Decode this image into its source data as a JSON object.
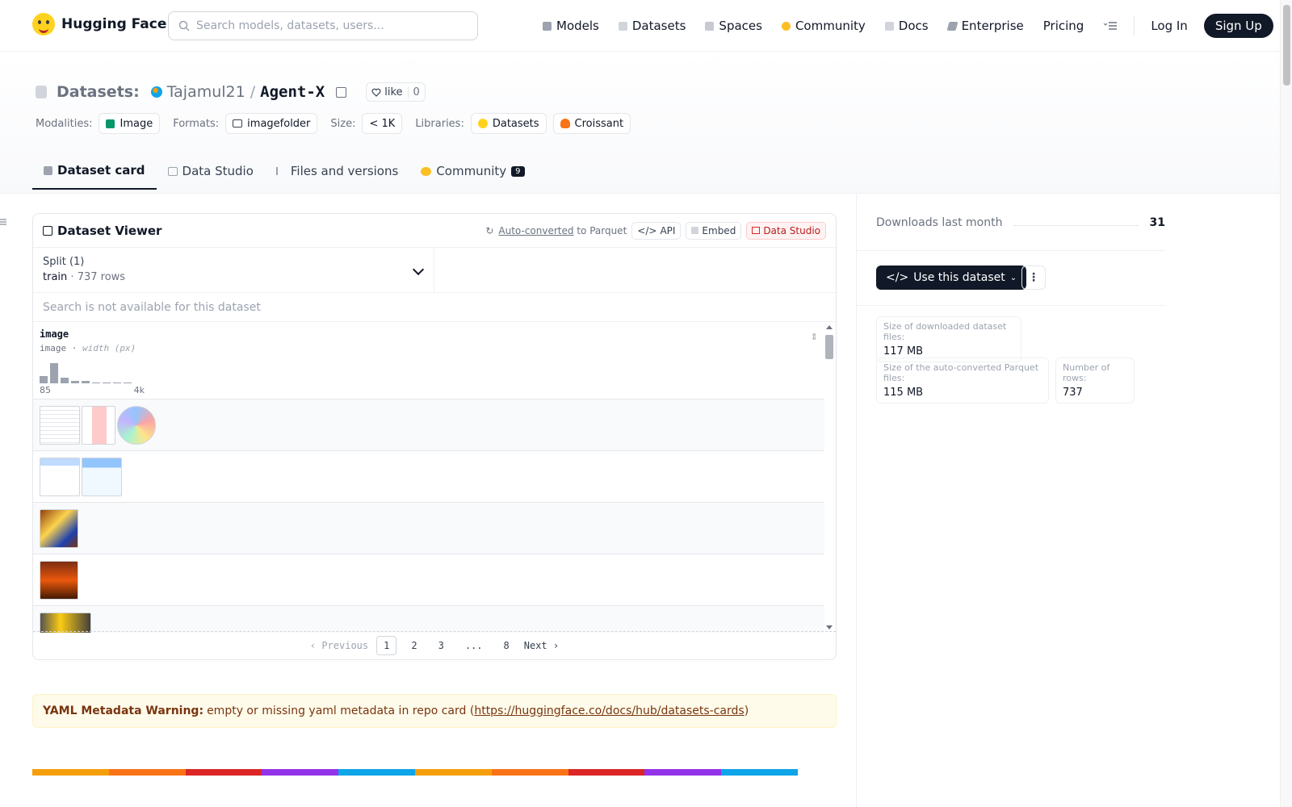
{
  "header": {
    "brand": "Hugging Face",
    "search_placeholder": "Search models, datasets, users...",
    "nav": [
      {
        "label": "Models",
        "icon": "cube-icon"
      },
      {
        "label": "Datasets",
        "icon": "database-icon"
      },
      {
        "label": "Spaces",
        "icon": "grid-icon"
      },
      {
        "label": "Community",
        "icon": "community-icon"
      },
      {
        "label": "Docs",
        "icon": "book-icon"
      },
      {
        "label": "Enterprise",
        "icon": "enterprise-icon"
      },
      {
        "label": "Pricing",
        "icon": ""
      }
    ],
    "login": "Log In",
    "signup": "Sign Up"
  },
  "title": {
    "section": "Datasets:",
    "owner": "Tajamul21",
    "separator": "/",
    "repo": "Agent-X",
    "like_label": "like",
    "like_count": "0"
  },
  "tags": {
    "modalities_label": "Modalities:",
    "modality": "Image",
    "formats_label": "Formats:",
    "format": "imagefolder",
    "size_label": "Size:",
    "size": "< 1K",
    "libraries_label": "Libraries:",
    "libraries": [
      "Datasets",
      "Croissant"
    ]
  },
  "tabs": [
    {
      "label": "Dataset card",
      "active": true
    },
    {
      "label": "Data Studio",
      "active": false
    },
    {
      "label": "Files and versions",
      "active": false
    },
    {
      "label": "Community",
      "active": false,
      "badge": "9"
    }
  ],
  "viewer": {
    "title": "Dataset Viewer",
    "auto_converted": "Auto-converted",
    "to_parquet": "to Parquet",
    "api": "API",
    "embed": "Embed",
    "data_studio": "Data Studio",
    "split_label": "Split (1)",
    "split_name": "train",
    "split_sep": "·",
    "split_rows": "737 rows",
    "search_na": "Search is not available for this dataset",
    "column": {
      "name": "image",
      "type": "image",
      "type_sep": "·",
      "type_hint": "width (px)",
      "hist_min": "85",
      "hist_max": "4k",
      "hist_values": [
        0.35,
        0.95,
        0.25,
        0.1,
        0.1,
        0.05,
        0.0,
        0.0,
        0.02
      ]
    },
    "pager": {
      "previous": "Previous",
      "pages": [
        "1",
        "2",
        "3",
        "...",
        "8"
      ],
      "current": "1",
      "next": "Next"
    }
  },
  "warning": {
    "bold": "YAML Metadata Warning:",
    "text": "empty or missing yaml metadata in repo card (",
    "link": "https://huggingface.co/docs/hub/datasets-cards",
    "tail": ")"
  },
  "right": {
    "downloads_label": "Downloads last month",
    "downloads_count": "31",
    "use_dataset": "Use this dataset",
    "stats": [
      {
        "label": "Size of downloaded dataset files:",
        "value": "117 MB"
      },
      {
        "label": "Size of the auto-converted Parquet files:",
        "value": "115 MB"
      },
      {
        "label": "Number of rows:",
        "value": "737"
      }
    ]
  },
  "colors": {
    "brand_yellow": "#ffd21e",
    "dark": "#111827",
    "warning_bg": "#fffbeb",
    "rainbow": [
      "#f59e0b",
      "#f97316",
      "#dc2626",
      "#9333ea",
      "#0ea5e9",
      "#f59e0b",
      "#f97316",
      "#dc2626",
      "#9333ea",
      "#0ea5e9"
    ]
  }
}
